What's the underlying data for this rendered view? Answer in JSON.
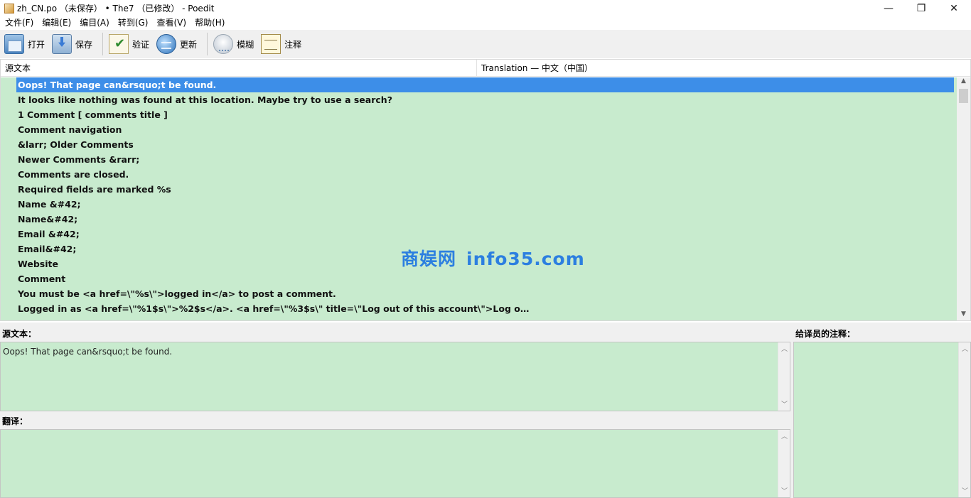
{
  "window": {
    "title": "zh_CN.po （未保存） • The7 （已修改） - Poedit",
    "min_glyph": "—",
    "max_glyph": "❐",
    "close_glyph": "✕"
  },
  "menu": [
    "文件(F)",
    "编辑(E)",
    "编目(A)",
    "转到(G)",
    "查看(V)",
    "帮助(H)"
  ],
  "toolbar": {
    "open": "打开",
    "save": "保存",
    "validate": "验证",
    "update": "更新",
    "fuzzy": "模糊",
    "comment": "注释"
  },
  "list": {
    "col_source": "源文本",
    "col_translation": "Translation — 中文（中国）",
    "rows": [
      "Oops! That page can&rsquo;t be found.",
      "It looks like nothing was found at this location. Maybe try to use a search?",
      "1 Comment  [ comments title ]",
      "Comment navigation",
      "&larr; Older Comments",
      "Newer Comments &rarr;",
      "Comments are closed.",
      "Required fields are marked %s",
      "Name &#42;",
      "Name&#42;",
      "Email &#42;",
      "Email&#42;",
      "Website",
      "Comment",
      "You must be <a href=\\\"%s\\\">logged in</a> to post a comment.",
      "Logged in as <a href=\\\"%1$s\\\">%2$s</a>. <a href=\\\"%3$s\\\" title=\\\"Log out of this account\\\">Log o…"
    ]
  },
  "watermark": {
    "part_a": "商娱网",
    "part_b": "info35.com"
  },
  "editor": {
    "source_label": "源文本：",
    "source_text": "Oops! That page can&rsquo;t be found.",
    "translation_label": "翻译：",
    "translation_text": "",
    "notes_label": "给译员的注释："
  }
}
